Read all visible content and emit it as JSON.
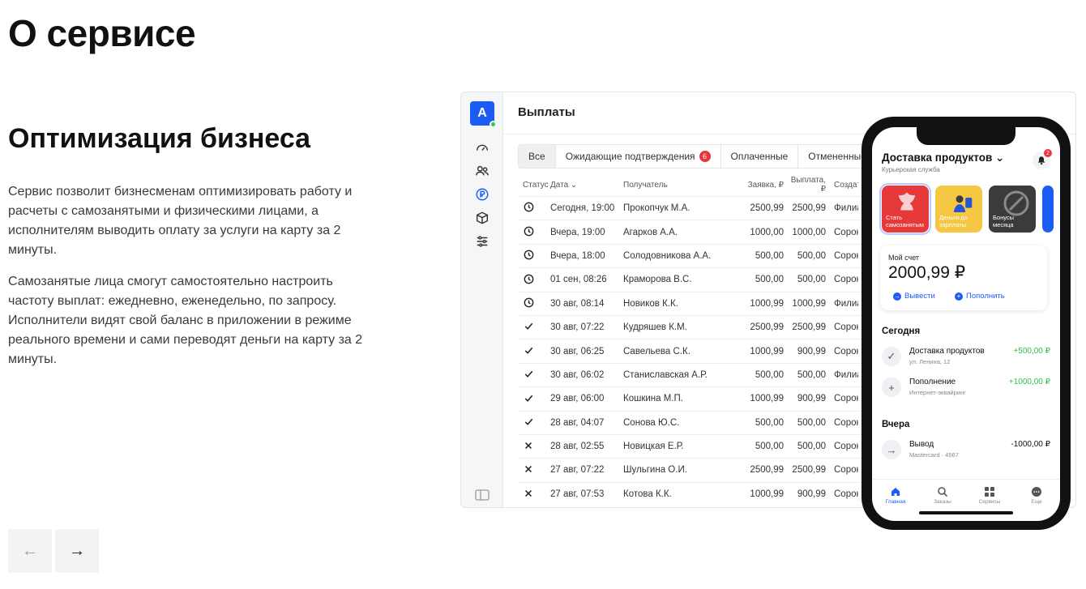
{
  "heading": "О сервисе",
  "section": {
    "title": "Оптимизация бизнеса",
    "para1": "Сервис позволит бизнесменам оптимизировать работу и расчеты с самозанятыми и физическими лицами, а исполнителям выводить оплату за услуги на карту за 2 минуты.",
    "para2": "Самозанятые лица смогут самостоятельно настроить частоту выплат: ежедневно, еженедельно, по запросу. Исполнители видят свой баланс в приложении в режиме реального времени и сами переводят деньги на карту за 2 минуты."
  },
  "nav": {
    "prev_icon": "arrow-left-icon",
    "next_icon": "arrow-right-icon",
    "prev": "←",
    "next": "→"
  },
  "app": {
    "logo": "A",
    "title": "Выплаты",
    "tabs": [
      {
        "label": "Все",
        "active": true
      },
      {
        "label": "Ожидающие подтверждения",
        "badge": "6"
      },
      {
        "label": "Оплаченные"
      },
      {
        "label": "Отмененные"
      }
    ],
    "columns": {
      "status": "Статус",
      "date": "Дата ⌄",
      "recipient": "Получатель",
      "request": "Заявка, ₽",
      "payout": "Выплата, ₽",
      "created": "Создате"
    },
    "rows": [
      {
        "status": "clock",
        "date": "Сегодня, 19:00",
        "recipient": "Прокопчук М.А.",
        "request": "2500,99",
        "payout": "2500,99",
        "created": "Филиа"
      },
      {
        "status": "clock",
        "date": "Вчера, 19:00",
        "recipient": "Агарков А.А.",
        "request": "1000,00",
        "payout": "1000,00",
        "created": "Сорок"
      },
      {
        "status": "clock",
        "date": "Вчера, 18:00",
        "recipient": "Солодовникова А.А.",
        "request": "500,00",
        "payout": "500,00",
        "created": "Сорок"
      },
      {
        "status": "clock",
        "date": "01 сен, 08:26",
        "recipient": "Краморова В.С.",
        "request": "500,00",
        "payout": "500,00",
        "created": "Сорок"
      },
      {
        "status": "clock",
        "date": "30 авг, 08:14",
        "recipient": "Новиков К.К.",
        "request": "1000,99",
        "payout": "1000,99",
        "created": "Филиа"
      },
      {
        "status": "check",
        "date": "30 авг, 07:22",
        "recipient": "Кудряшев К.М.",
        "request": "2500,99",
        "payout": "2500,99",
        "created": "Сорок"
      },
      {
        "status": "check",
        "date": "30 авг, 06:25",
        "recipient": "Савельева С.К.",
        "request": "1000,99",
        "payout": "900,99",
        "created": "Сорок"
      },
      {
        "status": "check",
        "date": "30 авг, 06:02",
        "recipient": "Станиславская А.Р.",
        "request": "500,00",
        "payout": "500,00",
        "created": "Филиа"
      },
      {
        "status": "check",
        "date": "29 авг, 06:00",
        "recipient": "Кошкина М.П.",
        "request": "1000,99",
        "payout": "900,99",
        "created": "Сорок"
      },
      {
        "status": "check",
        "date": "28 авг, 04:07",
        "recipient": "Сонова Ю.С.",
        "request": "500,00",
        "payout": "500,00",
        "created": "Сорок"
      },
      {
        "status": "cross",
        "date": "28 авг, 02:55",
        "recipient": "Новицкая Е.Р.",
        "request": "500,00",
        "payout": "500,00",
        "created": "Сорок"
      },
      {
        "status": "cross",
        "date": "27 авг, 07:22",
        "recipient": "Шульгина О.И.",
        "request": "2500,99",
        "payout": "2500,99",
        "created": "Сорок"
      },
      {
        "status": "cross",
        "date": "27 авг, 07:53",
        "recipient": "Котова К.К.",
        "request": "1000,99",
        "payout": "900,99",
        "created": "Сорок"
      }
    ]
  },
  "phone": {
    "title": "Доставка продуктов ⌄",
    "subtitle": "Курьерская служба",
    "bell_badge": "2",
    "stories": [
      "Стать самозанятым",
      "Деньги до зарплаты",
      "Бонусы месяца"
    ],
    "account_label": "Мой счет",
    "balance": "2000,99 ₽",
    "withdraw": "Вывести",
    "topup": "Пополнить",
    "today_label": "Сегодня",
    "yesterday_label": "Вчера",
    "ops": [
      {
        "icon": "✓",
        "name": "Доставка продуктов",
        "sub": "ул. Ленина, 12",
        "amount": "+500,00 ₽"
      },
      {
        "icon": "+",
        "name": "Пополнение",
        "sub": "Интернет-эквайринг",
        "amount": "+1000,00 ₽"
      },
      {
        "icon": "→",
        "name": "Вывод",
        "sub": "Mastercard · 4567",
        "amount": "-1000,00 ₽"
      }
    ],
    "tabbar": [
      "Главная",
      "Заказы",
      "Сервисы",
      "Еще"
    ]
  },
  "colors": {
    "accent": "#1b5cf5",
    "badge": "#e8353b",
    "positive": "#2dbf4a"
  }
}
